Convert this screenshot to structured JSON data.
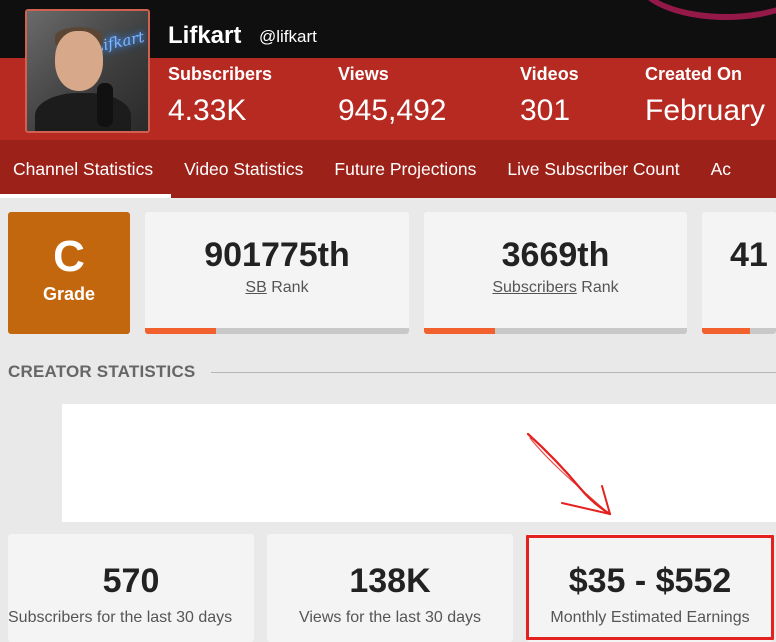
{
  "channel": {
    "name": "Lifkart",
    "handle": "@lifkart",
    "avatar_neon_text": "Lifkart"
  },
  "header_stats": [
    {
      "label": "Subscribers",
      "value": "4.33K"
    },
    {
      "label": "Views",
      "value": "945,492"
    },
    {
      "label": "Videos",
      "value": "301"
    },
    {
      "label": "Created On",
      "value": "February"
    }
  ],
  "nav": {
    "tabs": [
      {
        "label": "Channel Statistics",
        "active": true
      },
      {
        "label": "Video Statistics",
        "active": false
      },
      {
        "label": "Future Projections",
        "active": false
      },
      {
        "label": "Live Subscriber Count",
        "active": false
      },
      {
        "label": "Ac",
        "active": false
      }
    ]
  },
  "grade": {
    "letter": "C",
    "label": "Grade"
  },
  "ranks": [
    {
      "value": "901775th",
      "link": "SB",
      "suffix": " Rank",
      "fill": 0.27
    },
    {
      "value": "3669th",
      "link": "Subscribers",
      "suffix": " Rank",
      "fill": 0.27
    },
    {
      "value": "41",
      "link": "",
      "suffix": "",
      "fill": 0.65
    }
  ],
  "creator_statistics": {
    "title": "CREATOR STATISTICS",
    "cards": [
      {
        "value": "570",
        "label": "Subscribers for the last 30 days"
      },
      {
        "value": "138K",
        "label": "Views for the last 30 days"
      },
      {
        "value": "$35 - $552",
        "label": "Monthly Estimated Earnings"
      }
    ]
  },
  "colors": {
    "header_red": "#b62a22",
    "nav_red": "#9c2118",
    "grade_orange": "#c3670f",
    "rank_bar": "#f2602e",
    "annotation_red": "#e3211f"
  }
}
